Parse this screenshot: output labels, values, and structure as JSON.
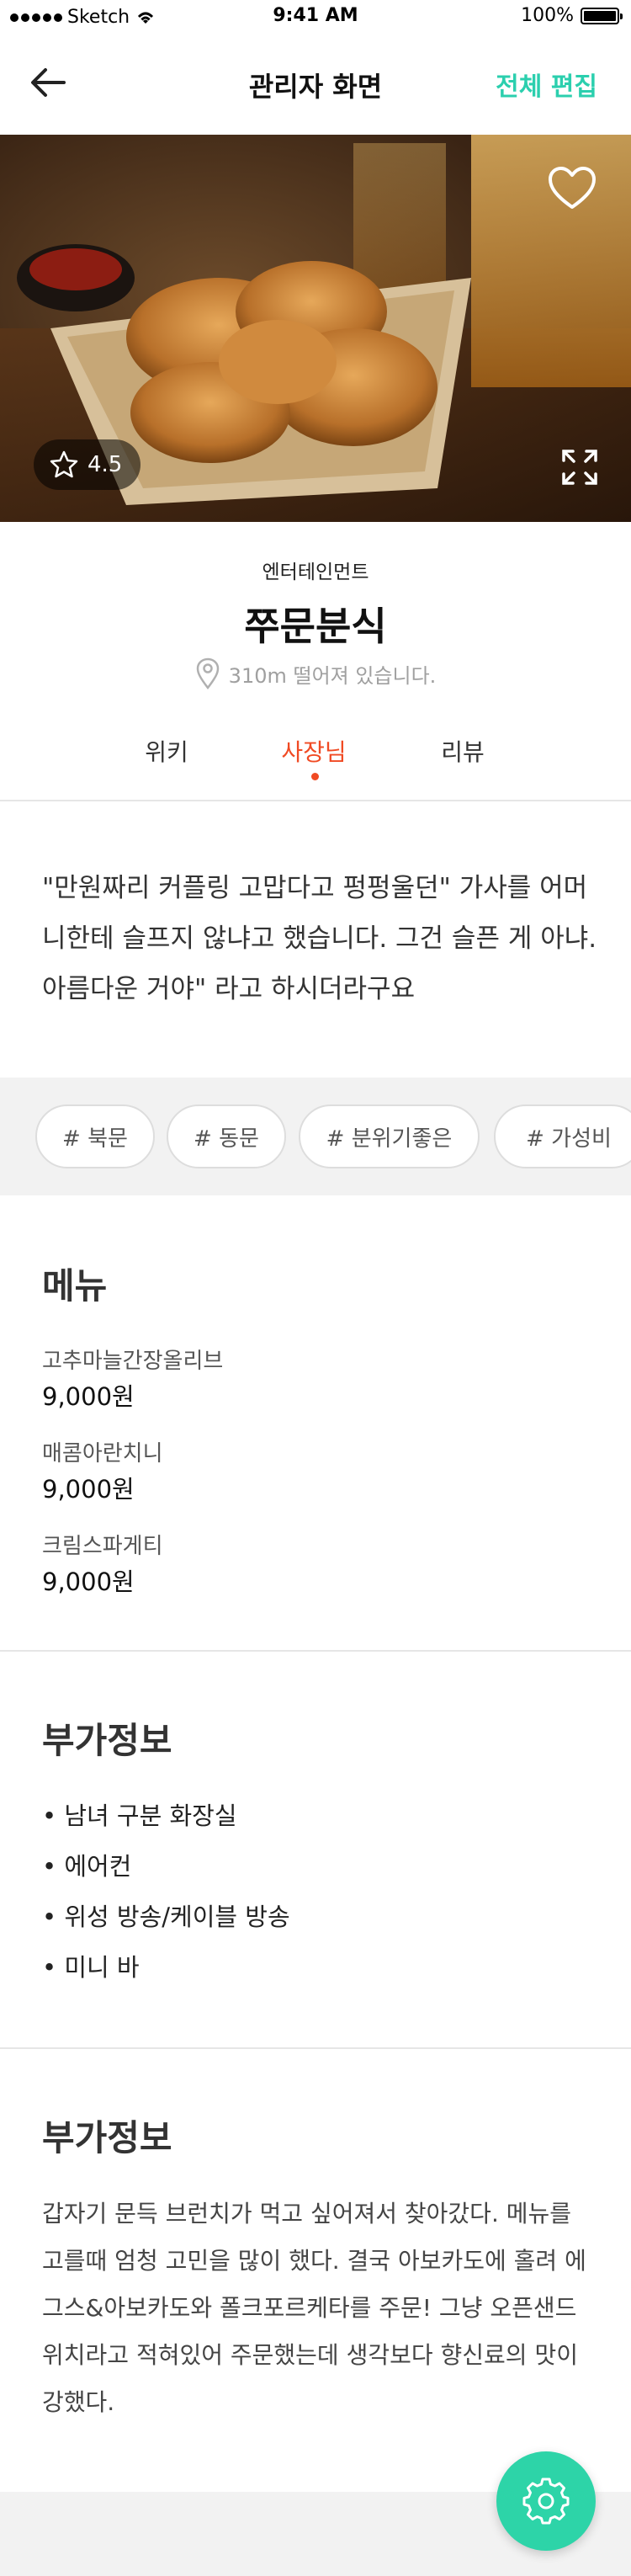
{
  "status_bar": {
    "carrier": "Sketch",
    "time": "9:41 AM",
    "battery": "100%"
  },
  "nav": {
    "title": "관리자 화면",
    "edit_label": "전체 편집"
  },
  "hero": {
    "rating": "4.5"
  },
  "shop": {
    "category": "엔터테인먼트",
    "name": "쭈문분식",
    "distance": "310m 떨어져 있습니다."
  },
  "tabs": [
    {
      "label": "위키",
      "active": false
    },
    {
      "label": "사장님",
      "active": true
    },
    {
      "label": "리뷰",
      "active": false
    }
  ],
  "quote": "\"만원짜리 커플링 고맙다고 펑펑울던\" 가사를 어머니한테 슬프지 않냐고 했습니다. 그건 슬픈 게 아냐. 아름다운 거야\" 라고 하시더라구요",
  "tags": [
    "# 북문",
    "# 동문",
    "# 분위기좋은",
    "# 가성비"
  ],
  "menu": {
    "title": "메뉴",
    "items": [
      {
        "name": "고추마늘간장올리브",
        "price": "9,000원"
      },
      {
        "name": "매콤아란치니",
        "price": "9,000원"
      },
      {
        "name": "크림스파게티",
        "price": "9,000원"
      }
    ]
  },
  "extra_info": {
    "title": "부가정보",
    "items": [
      "• 남녀 구분 화장실",
      "• 에어컨",
      "• 위성 방송/케이블 방송",
      "• 미니 바"
    ]
  },
  "extra_info2": {
    "title": "부가정보",
    "text": "갑자기 문득 브런치가 먹고 싶어져서 찾아갔다. 메뉴를 고를때 엄청 고민을 많이 했다. 결국 아보카도에 홀려 에그스&아보카도와 폴크포르케타를 주문! 그냥 오픈샌드위치라고 적혀있어 주문했는데 생각보다 향신료의 맛이 강했다."
  },
  "colors": {
    "accent": "#2bcfae",
    "active_tab": "#f04a23",
    "fab": "#2dd4a8"
  },
  "icons": [
    "back-arrow-icon",
    "heart-icon",
    "star-icon",
    "expand-icon",
    "location-pin-icon",
    "gear-icon",
    "wifi-icon",
    "battery-icon"
  ]
}
